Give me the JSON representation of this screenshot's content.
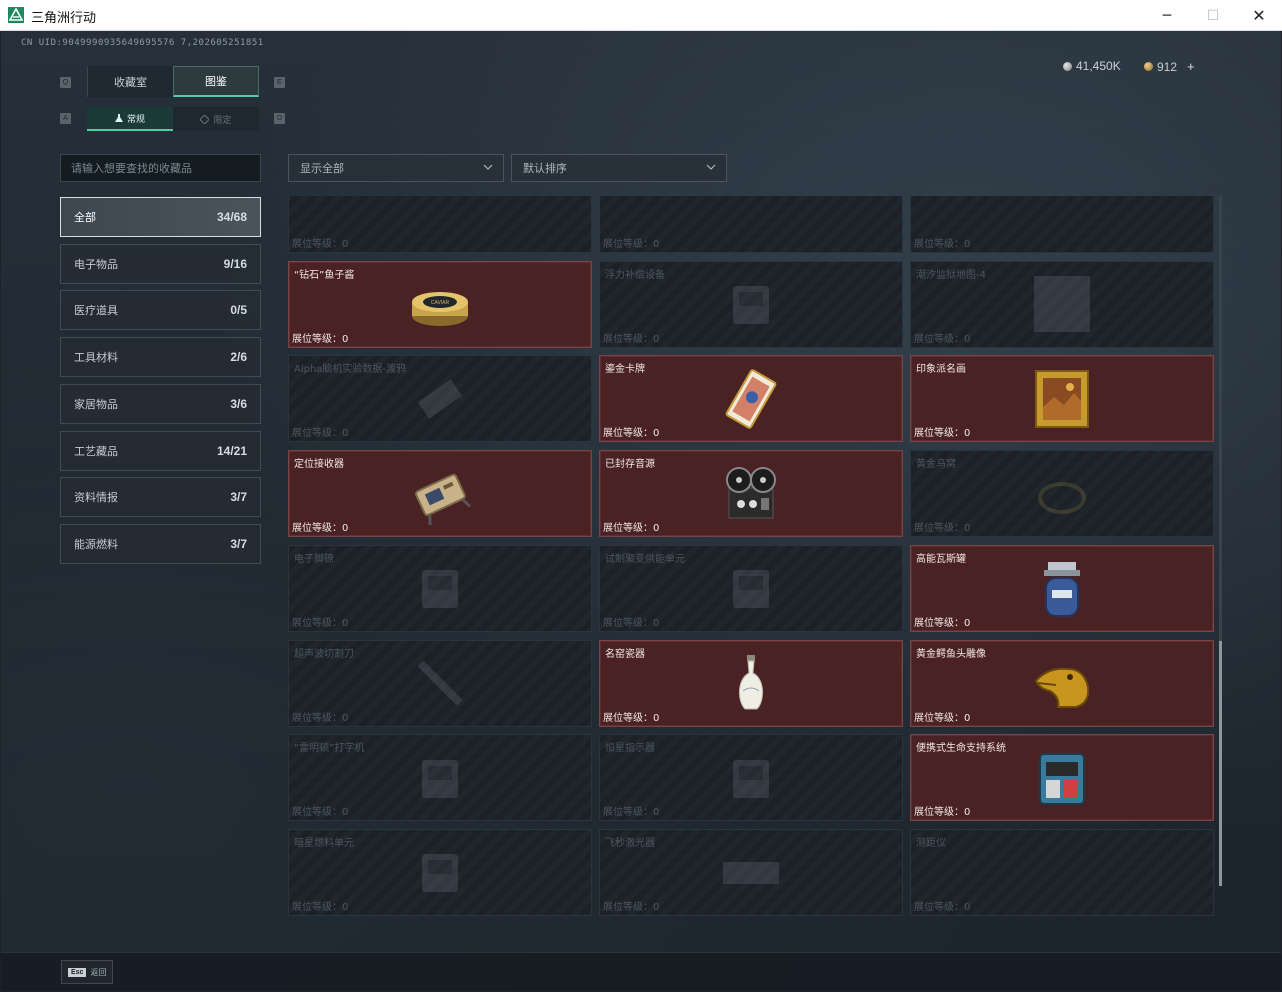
{
  "window": {
    "title": "三角洲行动",
    "minimize_glyph": "─",
    "maximize_glyph": "☐",
    "close_glyph": "✕"
  },
  "header": {
    "uid": "CN UID:9049990935649695576 7,202605251851",
    "currency": [
      {
        "icon": "silver-coin-icon",
        "value": "41,450K"
      },
      {
        "icon": "gold-coin-icon",
        "value": "912"
      }
    ],
    "plus": "+"
  },
  "tabs": {
    "left_key": "Q",
    "right_key": "E",
    "items": [
      {
        "label": "收藏室"
      },
      {
        "label": "图鉴"
      }
    ]
  },
  "subtabs": {
    "left_key": "A",
    "right_key": "D",
    "items": [
      {
        "label": "常规"
      },
      {
        "label": "限定"
      }
    ]
  },
  "filters": {
    "search_placeholder": "请输入想要查找的收藏品",
    "dropdown1": "显示全部",
    "dropdown2": "默认排序"
  },
  "categories": [
    {
      "label": "全部",
      "count": "34/68"
    },
    {
      "label": "电子物品",
      "count": "9/16"
    },
    {
      "label": "医疗道具",
      "count": "0/5"
    },
    {
      "label": "工具材料",
      "count": "2/6"
    },
    {
      "label": "家居物品",
      "count": "3/6"
    },
    {
      "label": "工艺藏品",
      "count": "14/21"
    },
    {
      "label": "资料情报",
      "count": "3/7"
    },
    {
      "label": "能源燃料",
      "count": "3/7"
    }
  ],
  "level_label": "展位等级：0",
  "items": [
    {
      "name": "",
      "owned": false,
      "icon": ""
    },
    {
      "name": "",
      "owned": false,
      "icon": ""
    },
    {
      "name": "",
      "owned": false,
      "icon": ""
    },
    {
      "name": "“钻石”鱼子酱",
      "owned": true,
      "icon": "caviar"
    },
    {
      "name": "浮力补偿设备",
      "owned": false,
      "icon": "device"
    },
    {
      "name": "潮汐监狱地图-4",
      "owned": false,
      "icon": "map"
    },
    {
      "name": "Alpha脑机实验数据-渡鸦",
      "owned": false,
      "icon": "drive"
    },
    {
      "name": "鎏金卡牌",
      "owned": true,
      "icon": "card"
    },
    {
      "name": "印象派名画",
      "owned": true,
      "icon": "painting"
    },
    {
      "name": "定位接收器",
      "owned": true,
      "icon": "receiver"
    },
    {
      "name": "已封存音源",
      "owned": true,
      "icon": "reel"
    },
    {
      "name": "黄金鸟窝",
      "owned": false,
      "icon": "nest"
    },
    {
      "name": "电子脚镣",
      "owned": false,
      "icon": "device"
    },
    {
      "name": "试制聚变供能单元",
      "owned": false,
      "icon": "device"
    },
    {
      "name": "高能瓦斯罐",
      "owned": true,
      "icon": "gas"
    },
    {
      "name": "超声波切割刀",
      "owned": false,
      "icon": "knife"
    },
    {
      "name": "名窑瓷器",
      "owned": true,
      "icon": "vase"
    },
    {
      "name": "黄金鳄鱼头雕像",
      "owned": true,
      "icon": "croc"
    },
    {
      "name": "“雷明顿”打字机",
      "owned": false,
      "icon": "device"
    },
    {
      "name": "恒星指示器",
      "owned": false,
      "icon": "device"
    },
    {
      "name": "便携式生命支持系统",
      "owned": true,
      "icon": "life"
    },
    {
      "name": "暗星燃料单元",
      "owned": false,
      "icon": "device"
    },
    {
      "name": "飞秒激光器",
      "owned": false,
      "icon": "laser"
    },
    {
      "name": "测距仪",
      "owned": false,
      "icon": ""
    }
  ],
  "footer": {
    "key": "Esc",
    "label": "返回"
  },
  "colors": {
    "accent": "#3fd3a6",
    "owned_card": "#4a2224",
    "locked_card": "#1b2127"
  }
}
